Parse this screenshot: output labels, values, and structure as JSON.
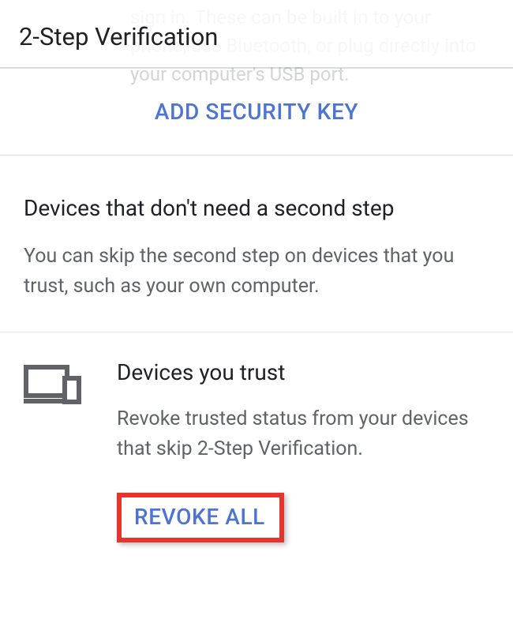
{
  "ghost_text": "sign in. These can be built in to your phone, use Bluetooth, or plug directly into your computer's USB port.",
  "header": {
    "title": "2-Step Verification"
  },
  "security_key": {
    "action_label": "Add Security Key"
  },
  "devices_section": {
    "title": "Devices that don't need a second step",
    "description": "You can skip the second step on devices that you trust, such as your own computer."
  },
  "trust_section": {
    "title": "Devices you trust",
    "description": "Revoke trusted status from your devices that skip 2-Step Verification.",
    "revoke_label": "Revoke All"
  },
  "colors": {
    "accent": "#4c74d0",
    "highlight_border": "#e5352d"
  }
}
